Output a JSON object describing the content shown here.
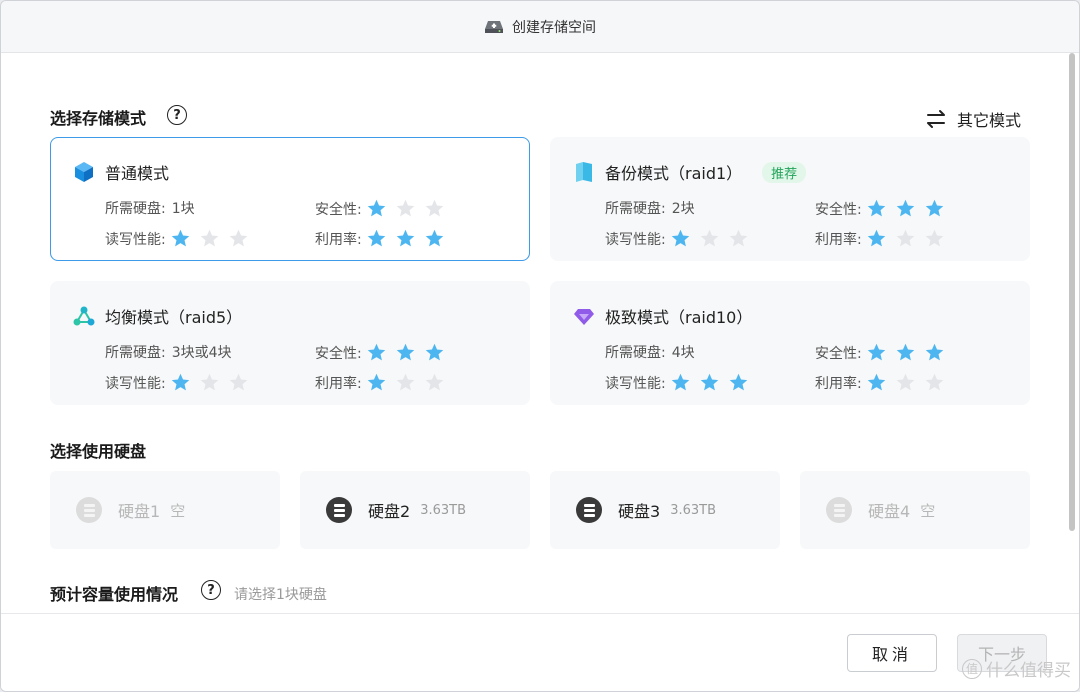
{
  "window": {
    "title": "创建存储空间"
  },
  "sections": {
    "mode_title": "选择存储模式",
    "disk_title": "选择使用硬盘",
    "capacity_title": "预计容量使用情况",
    "capacity_hint": "请选择1块硬盘",
    "help_glyph": "?"
  },
  "other_mode": {
    "label": "其它模式"
  },
  "modes": [
    {
      "name": "普通模式",
      "icon": "cube-icon",
      "selected": true,
      "disks_label": "所需硬盘:",
      "disks_value": "1块",
      "security_label": "安全性:",
      "security": 1,
      "rw_label": "读写性能:",
      "rw": 1,
      "util_label": "利用率:",
      "util": 3
    },
    {
      "name": "备份模式（raid1）",
      "icon": "book-icon",
      "badge": "推荐",
      "disks_label": "所需硬盘:",
      "disks_value": "2块",
      "security_label": "安全性:",
      "security": 3,
      "rw_label": "读写性能:",
      "rw": 1,
      "util_label": "利用率:",
      "util": 1
    },
    {
      "name": "均衡模式（raid5）",
      "icon": "network-icon",
      "disks_label": "所需硬盘:",
      "disks_value": "3块或4块",
      "security_label": "安全性:",
      "security": 3,
      "rw_label": "读写性能:",
      "rw": 1,
      "util_label": "利用率:",
      "util": 1
    },
    {
      "name": "极致模式（raid10）",
      "icon": "diamond-icon",
      "disks_label": "所需硬盘:",
      "disks_value": "4块",
      "security_label": "安全性:",
      "security": 3,
      "rw_label": "读写性能:",
      "rw": 3,
      "util_label": "利用率:",
      "util": 1
    }
  ],
  "disks": [
    {
      "name": "硬盘1",
      "size": "空",
      "enabled": false
    },
    {
      "name": "硬盘2",
      "size": "3.63TB",
      "enabled": true
    },
    {
      "name": "硬盘3",
      "size": "3.63TB",
      "enabled": true
    },
    {
      "name": "硬盘4",
      "size": "空",
      "enabled": false
    }
  ],
  "footer": {
    "cancel": "取消",
    "next": "下一步"
  },
  "watermark": {
    "badge": "值",
    "text": "什么值得买"
  },
  "colors": {
    "star_on": "#4db6f0",
    "star_off": "#e3e5e8",
    "selected_border": "#3d9be9",
    "badge_green": "#22a35a"
  }
}
